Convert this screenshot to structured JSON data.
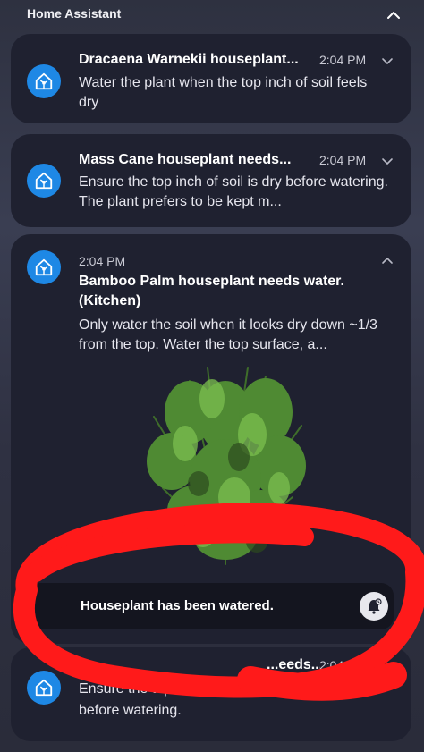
{
  "app": {
    "title": "Home Assistant"
  },
  "notifications": [
    {
      "title": "Dracaena Warnekii houseplant...",
      "time": "2:04 PM",
      "body": "Water the plant when the top inch of soil feels dry"
    },
    {
      "title": "Mass Cane houseplant needs...",
      "time": "2:04 PM",
      "body": "Ensure the top inch of soil is dry before watering. The plant prefers to be kept m..."
    },
    {
      "time": "2:04 PM",
      "title": "Bamboo Palm houseplant needs water. (Kitchen)",
      "body": "Only water the soil when it looks dry down ~1/3 from the top. Water the top surface, a...",
      "action": "Houseplant has been watered."
    },
    {
      "title": "...eeds...",
      "time": "2:04 PM",
      "body_line1": "Ensure the top 1-2 inches o",
      "body_line2": "before watering."
    }
  ],
  "colors": {
    "accent": "#1e88e5",
    "annotation": "#ff1a1a",
    "card": "#1f2130"
  }
}
